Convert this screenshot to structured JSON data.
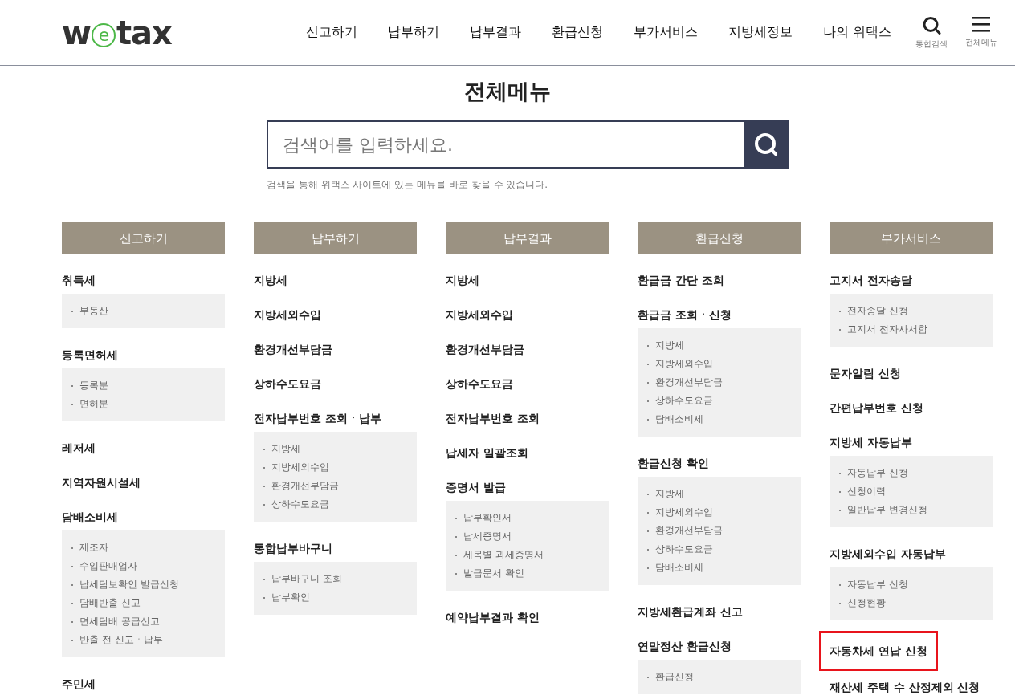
{
  "header": {
    "logo": [
      "w",
      "e",
      "tax"
    ],
    "nav": [
      "신고하기",
      "납부하기",
      "납부결과",
      "환급신청",
      "부가서비스",
      "지방세정보",
      "나의 위택스"
    ],
    "tools": [
      {
        "kind": "search",
        "label": "통합검색"
      },
      {
        "kind": "menu",
        "label": "전체메뉴"
      }
    ]
  },
  "title": "전체메뉴",
  "search": {
    "placeholder": "검색어를 입력하세요.",
    "hint": "검색을 통해 위택스 사이트에 있는 메뉴를 바로 찾을 수 있습니다."
  },
  "columns": [
    {
      "heading": "신고하기",
      "groups": [
        {
          "title": "취득세",
          "items": [
            "부동산"
          ]
        },
        {
          "title": "등록면허세",
          "items": [
            "등록분",
            "면허분"
          ]
        },
        {
          "title": "레저세"
        },
        {
          "title": "지역자원시설세"
        },
        {
          "title": "담배소비세",
          "items": [
            "제조자",
            "수입판매업자",
            "납세담보확인 발급신청",
            "담배반출 신고",
            "면세담배 공급신고",
            "반출 전 신고ㆍ납부"
          ]
        },
        {
          "title": "주민세"
        }
      ]
    },
    {
      "heading": "납부하기",
      "groups": [
        {
          "title": "지방세"
        },
        {
          "title": "지방세외수입"
        },
        {
          "title": "환경개선부담금"
        },
        {
          "title": "상하수도요금"
        },
        {
          "title": "전자납부번호 조회ㆍ납부",
          "items": [
            "지방세",
            "지방세외수입",
            "환경개선부담금",
            "상하수도요금"
          ]
        },
        {
          "title": "통합납부바구니",
          "items": [
            "납부바구니 조회",
            "납부확인"
          ]
        }
      ]
    },
    {
      "heading": "납부결과",
      "groups": [
        {
          "title": "지방세"
        },
        {
          "title": "지방세외수입"
        },
        {
          "title": "환경개선부담금"
        },
        {
          "title": "상하수도요금"
        },
        {
          "title": "전자납부번호 조회"
        },
        {
          "title": "납세자 일괄조회"
        },
        {
          "title": "증명서 발급",
          "items": [
            "납부확인서",
            "납세증명서",
            "세목별 과세증명서",
            "발급문서 확인"
          ]
        },
        {
          "title": "예약납부결과 확인"
        }
      ]
    },
    {
      "heading": "환급신청",
      "groups": [
        {
          "title": "환급금 간단 조회"
        },
        {
          "title": "환급금 조회ㆍ신청",
          "items": [
            "지방세",
            "지방세외수입",
            "환경개선부담금",
            "상하수도요금",
            "담배소비세"
          ]
        },
        {
          "title": "환급신청 확인",
          "items": [
            "지방세",
            "지방세외수입",
            "환경개선부담금",
            "상하수도요금",
            "담배소비세"
          ]
        },
        {
          "title": "지방세환급계좌 신고"
        },
        {
          "title": "연말정산 환급신청",
          "items": [
            "환급신청"
          ]
        }
      ]
    },
    {
      "heading": "부가서비스",
      "groups": [
        {
          "title": "고지서 전자송달",
          "items": [
            "전자송달 신청",
            "고지서 전자사서함"
          ]
        },
        {
          "title": "문자알림 신청"
        },
        {
          "title": "간편납부번호 신청"
        },
        {
          "title": "지방세 자동납부",
          "items": [
            "자동납부 신청",
            "신청이력",
            "일반납부 변경신청"
          ]
        },
        {
          "title": "지방세외수입 자동납부",
          "items": [
            "자동납부 신청",
            "신청현황"
          ]
        },
        {
          "title": "자동차세 연납 신청",
          "highlighted": true
        },
        {
          "title": "재산세 주택 수 산정제외 신청"
        }
      ]
    }
  ]
}
